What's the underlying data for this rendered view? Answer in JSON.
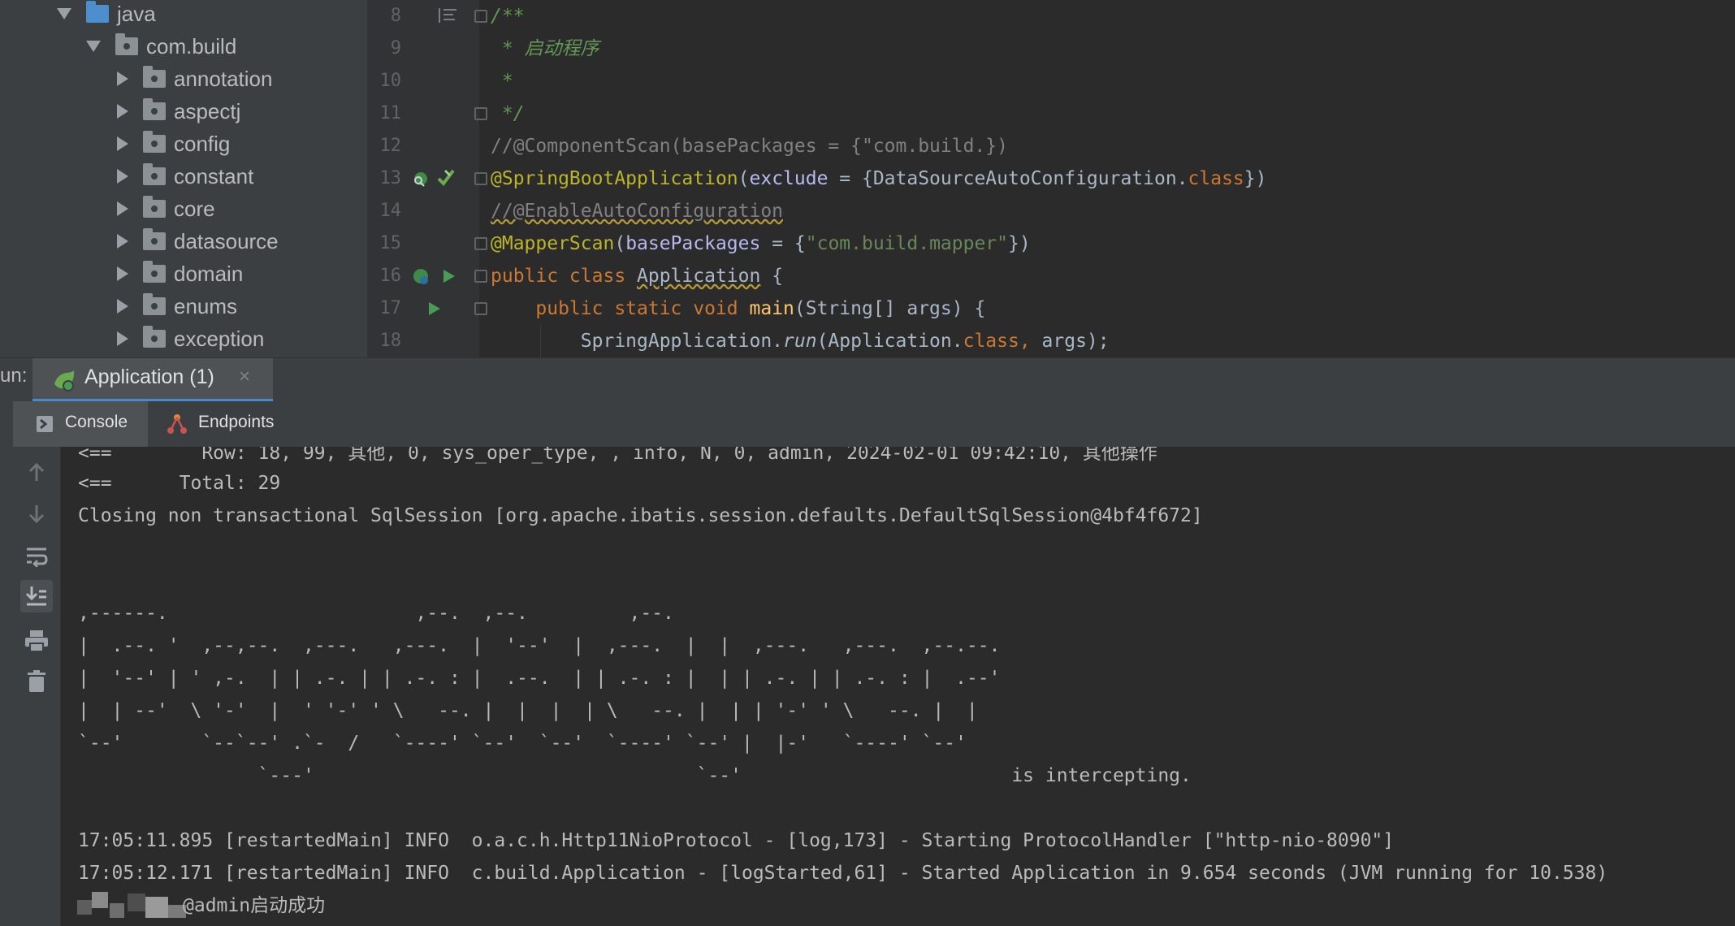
{
  "project_tree": {
    "items": [
      {
        "label": "java",
        "kind": "source-root",
        "expanded": true
      },
      {
        "label": "com.build",
        "kind": "package",
        "expanded": true
      },
      {
        "label": "annotation",
        "kind": "package",
        "expanded": false
      },
      {
        "label": "aspectj",
        "kind": "package",
        "expanded": false
      },
      {
        "label": "config",
        "kind": "package",
        "expanded": false
      },
      {
        "label": "constant",
        "kind": "package",
        "expanded": false
      },
      {
        "label": "core",
        "kind": "package",
        "expanded": false
      },
      {
        "label": "datasource",
        "kind": "package",
        "expanded": false
      },
      {
        "label": "domain",
        "kind": "package",
        "expanded": false
      },
      {
        "label": "enums",
        "kind": "package",
        "expanded": false
      },
      {
        "label": "exception",
        "kind": "package",
        "expanded": false
      }
    ]
  },
  "editor": {
    "line_numbers": [
      "8",
      "9",
      "10",
      "11",
      "12",
      "13",
      "14",
      "15",
      "16",
      "17",
      "18"
    ],
    "lines": {
      "l8": "/**",
      "l9": " * 启动程序",
      "l10": " *",
      "l11": " */",
      "l12": "//@ComponentScan(basePackages = {\"com.build.})",
      "l13_ann": "@SpringBootApplication",
      "l13_open": "(",
      "l13_param": "exclude",
      "l13_mid": " = {DataSourceAutoConfiguration.",
      "l13_kw": "class",
      "l13_close": "})",
      "l14": "//@EnableAutoConfiguration",
      "l15_ann": "@MapperScan",
      "l15_open": "(",
      "l15_param": "basePackages",
      "l15_mid": " = {",
      "l15_str": "\"com.build.mapper\"",
      "l15_close": "})",
      "l16_kw": "public class ",
      "l16_name": "Application",
      "l16_end": " {",
      "l17_indent": "    ",
      "l17_kw": "public static void ",
      "l17_fn": "main",
      "l17_end": "(String[] args) {",
      "l18_indent": "        ",
      "l18_cls": "SpringApplication.",
      "l18_fn": "run",
      "l18_mid": "(Application.",
      "l18_kw": "class, ",
      "l18_end": "args);"
    }
  },
  "run_panel": {
    "label": "un:",
    "config_tab": "Application (1)",
    "close_glyph": "×",
    "tabs": {
      "console": "Console",
      "endpoints": "Endpoints"
    }
  },
  "console": {
    "lines": {
      "c1": "<==        Row: 18, 99, 其他, 0, sys_oper_type, , info, N, 0, admin, 2024-02-01 09:42:10, 其他操作",
      "c2": "<==      Total: 29",
      "c3": "Closing non transactional SqlSession [org.apache.ibatis.session.defaults.DefaultSqlSession@4bf4f672]",
      "a1": ",------.                      ,--.  ,--.         ,--.",
      "a2": "|  .--. '  ,--,--.  ,---.   ,---.  |  '--'  |  ,---.  |  |  ,---.   ,---.  ,--.--.",
      "a3": "|  '--' | ' ,-.  | | .-. | | .-. : |  .--.  | | .-. : |  | | .-. | | .-. : |  .--'",
      "a4": "|  | --'  \\ '-'  |  ' '-' ' \\   --. |  |  |  | \\   --. |  | | '-' ' \\   --. |  |",
      "a5": "`--'       `--`--' .`-  /   `----' `--'  `--'  `----' `--' |  |-'   `----' `--'",
      "a6": "                `---'                                  `--'                        is intercepting.",
      "l1": "17:05:11.895 [restartedMain] INFO  o.a.c.h.Http11NioProtocol - [log,173] - Starting ProtocolHandler [\"http-nio-8090\"]",
      "l2": "17:05:12.171 [restartedMain] INFO  c.build.Application - [logStarted,61] - Started Application in 9.654 seconds (JVM running for 10.538)",
      "l3": "@admin启动成功"
    }
  },
  "colors": {
    "background": "#2b2b2b",
    "panel": "#3c3f41",
    "keyword": "#cc7832",
    "annotation": "#bbb529",
    "string": "#6a8759",
    "doc_comment": "#629755",
    "run_green": "#499c54"
  },
  "icons": {
    "gutter": [
      "align-left-icon",
      "spring-bean-icon",
      "spring-boot-icon",
      "run-icon"
    ],
    "console_tools": [
      "arrow-up-icon",
      "arrow-down-icon",
      "soft-wrap-icon",
      "scroll-to-end-icon",
      "print-icon",
      "trash-icon"
    ]
  }
}
